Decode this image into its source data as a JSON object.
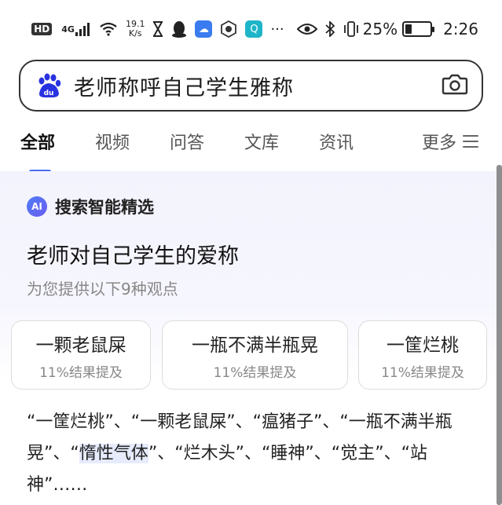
{
  "status_bar": {
    "hd": "HD",
    "signal": "4G",
    "speed_value": "19.1",
    "speed_unit": "K/s",
    "battery_percent": "25%",
    "time": "2:26"
  },
  "search": {
    "query": "老师称呼自己学生雅称"
  },
  "tabs": [
    {
      "label": "全部"
    },
    {
      "label": "视频"
    },
    {
      "label": "问答"
    },
    {
      "label": "文库"
    },
    {
      "label": "资讯"
    }
  ],
  "more_tab": {
    "label": "更多"
  },
  "ai_card": {
    "badge": "AI",
    "label": "搜索智能精选",
    "title": "老师对自己学生的爱称",
    "subtitle": "为您提供以下9种观点",
    "options": [
      {
        "title": "一颗老鼠屎",
        "sub": "11%结果提及"
      },
      {
        "title": "一瓶不满半瓶晃",
        "sub": "11%结果提及"
      },
      {
        "title": "一筐烂桃",
        "sub": "11%结果提及"
      }
    ],
    "body_before": "“一筐烂桃”、“一颗老鼠屎”、“瘟猪子”、“一瓶不满半瓶晃”、“",
    "body_highlight": "惰性气体",
    "body_after": "”、“烂木头”、“睡神”、“觉主”、“站神”……"
  },
  "colors": {
    "accent": "#4e6ef2",
    "baidu_blue": "#2932e1"
  }
}
